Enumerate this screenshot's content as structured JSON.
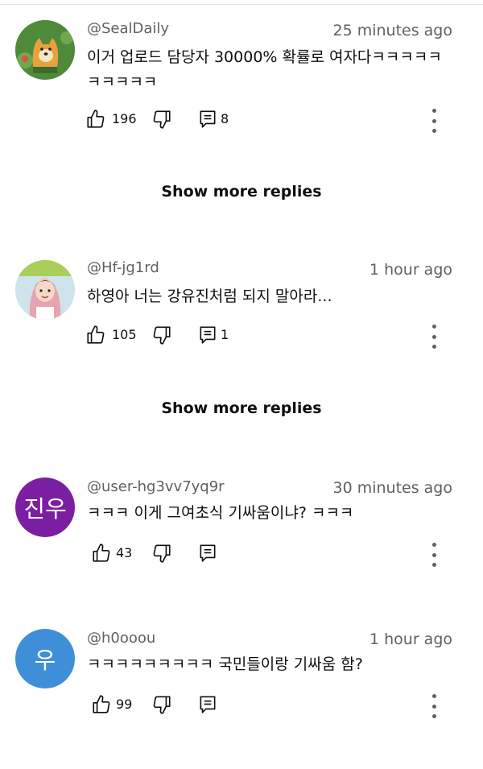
{
  "comments": [
    {
      "author": "@SealDaily",
      "time": "25 minutes ago",
      "text": "이거 업로드 담당자 30000% 확률로 여자다ㅋㅋㅋㅋㅋ ㅋㅋㅋㅋㅋ",
      "likes": "196",
      "replies": "8",
      "avatar": {
        "kind": "image",
        "subject": "shiba-dog",
        "bg": "#4a7a3a"
      }
    },
    {
      "author": "@Hf-jg1rd",
      "time": "1 hour ago",
      "text": "하영아 너는 강유진처럼 되지 말아라...",
      "likes": "105",
      "replies": "1",
      "avatar": {
        "kind": "image",
        "subject": "girl-photo",
        "bg": "#cfe3ea"
      }
    },
    {
      "author": "@user-hg3vv7yq9r",
      "time": "30 minutes ago",
      "text": "ㅋㅋㅋ 이게 그여초식 기싸움이냐? ㅋㅋㅋ",
      "likes": "43",
      "replies": "",
      "avatar": {
        "kind": "letter",
        "letter": "진우",
        "bg": "#7b1fa2"
      }
    },
    {
      "author": "@h0ooou",
      "time": "1 hour ago",
      "text": "ㅋㅋㅋㅋㅋㅋㅋㅋㅋ 국민들이랑 기싸움 함?",
      "likes": "99",
      "replies": "",
      "avatar": {
        "kind": "letter",
        "letter": "우",
        "bg": "#3f8fd8"
      }
    }
  ],
  "show_more_label": "Show more replies",
  "icons": {
    "like": "thumb-up-icon",
    "dislike": "thumb-down-icon",
    "reply": "reply-comment-icon",
    "menu": "more-vert-icon"
  }
}
